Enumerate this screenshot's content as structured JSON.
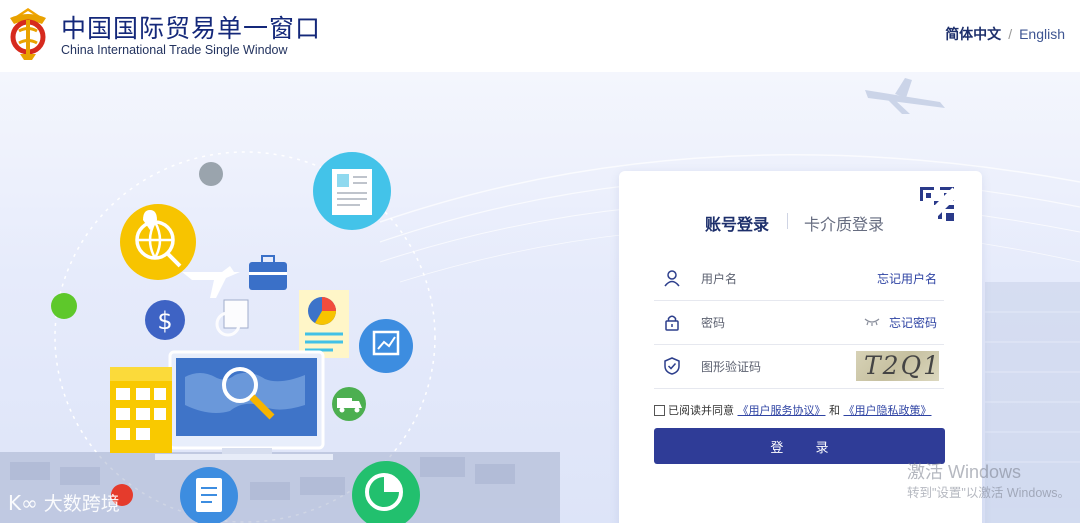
{
  "header": {
    "brand_cn": "中国国际贸易单一窗口",
    "brand_en": "China International Trade Single Window",
    "logo_icon": "single-window-emblem-icon",
    "lang_cn": "简体中文",
    "lang_sep": "/",
    "lang_en": "English"
  },
  "login": {
    "tab_account": "账号登录",
    "tab_card": "卡介质登录",
    "qr_icon": "qr-code-corner-icon",
    "username_placeholder": "用户名",
    "forgot_username": "忘记用户名",
    "password_placeholder": "密码",
    "forgot_password": "忘记密码",
    "captcha_placeholder": "图形验证码",
    "captcha_text": "T2Q1",
    "agree_prefix": "已阅读并同意",
    "agree_link1": "《用户服务协议》",
    "agree_and": "和",
    "agree_link2": "《用户隐私政策》",
    "submit_label": "登 录"
  },
  "watermark": {
    "windows_line1": "激活 Windows",
    "windows_line2": "转到\"设置\"以激活 Windows。",
    "brand": "大数跨境",
    "brand_mark": "K∞"
  },
  "colors": {
    "brand_navy": "#1d2f6b",
    "button": "#2f3c97",
    "link": "#2e43a3"
  }
}
